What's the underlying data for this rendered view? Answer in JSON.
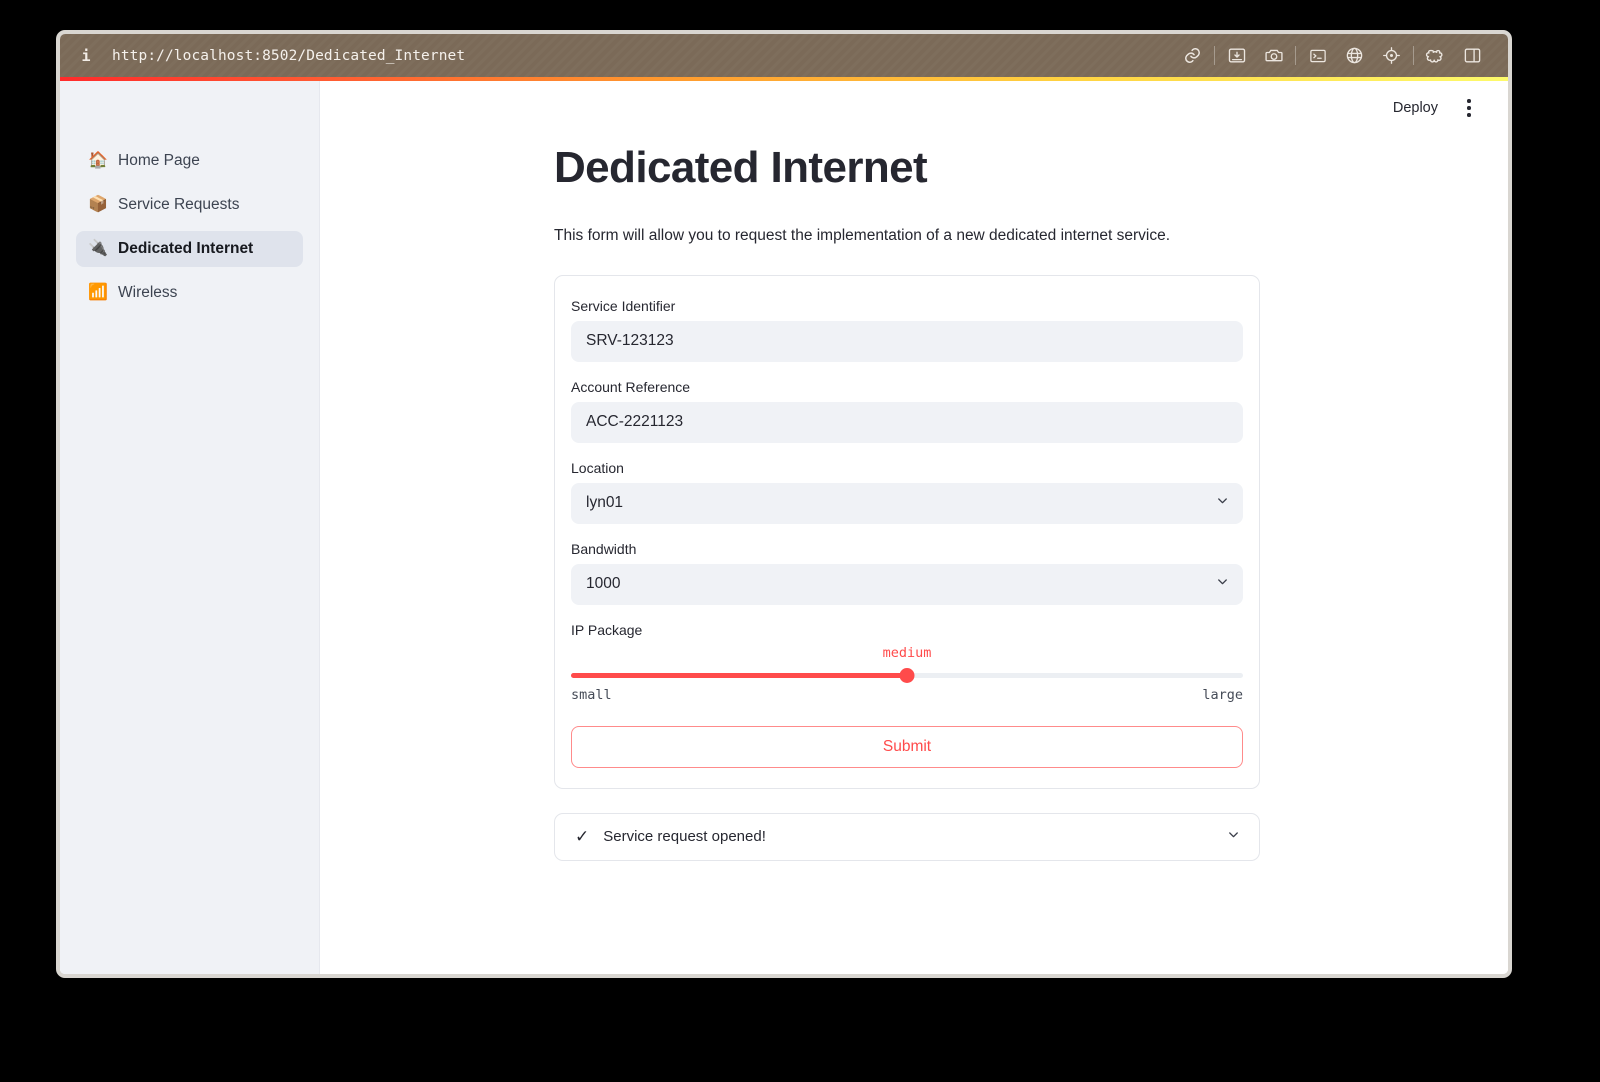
{
  "titlebar": {
    "info_icon": "i",
    "url": "http://localhost:8502/Dedicated_Internet",
    "icons": [
      {
        "name": "link-icon",
        "glyph": "link"
      },
      {
        "name": "download-image-icon",
        "glyph": "image-download"
      },
      {
        "name": "camera-icon",
        "glyph": "camera"
      },
      {
        "name": "terminal-icon",
        "glyph": "terminal"
      },
      {
        "name": "globe-icon",
        "glyph": "globe"
      },
      {
        "name": "crosshair-icon",
        "glyph": "crosshair"
      },
      {
        "name": "puzzle-icon",
        "glyph": "puzzle"
      },
      {
        "name": "split-panel-icon",
        "glyph": "panel"
      }
    ]
  },
  "sidebar": {
    "items": [
      {
        "label": "Home Page",
        "emoji": "🏠",
        "active": false
      },
      {
        "label": "Service Requests",
        "emoji": "📦",
        "active": false
      },
      {
        "label": "Dedicated Internet",
        "emoji": "🔌",
        "active": true
      },
      {
        "label": "Wireless",
        "emoji": "📶",
        "active": false
      }
    ]
  },
  "topbar": {
    "deploy_label": "Deploy",
    "menu_label": "More options"
  },
  "main": {
    "title": "Dedicated Internet",
    "subtitle": "This form will allow you to request the implementation of a new dedicated internet service."
  },
  "form": {
    "fields": [
      {
        "name": "service-identifier",
        "label": "Service Identifier",
        "value": "SRV-123123",
        "placeholder": "",
        "type": "text"
      },
      {
        "name": "account-reference",
        "label": "Account Reference",
        "value": "ACC-2221123",
        "placeholder": "",
        "type": "text"
      },
      {
        "name": "location",
        "label": "Location",
        "value": "lyn01",
        "placeholder": "",
        "type": "select"
      },
      {
        "name": "bandwidth",
        "label": "Bandwidth",
        "value": "1000",
        "placeholder": "",
        "type": "select"
      }
    ],
    "slider": {
      "label": "IP Package",
      "value": "medium",
      "min_label": "small",
      "max_label": "large",
      "percent": 50
    },
    "submit_label": "Submit"
  },
  "status": {
    "check_glyph": "✓",
    "text": "Service request opened!",
    "expanded": false
  },
  "colors": {
    "accent_red": "#ff4b4b",
    "titlebar_brown": "#7b6a58",
    "sidebar_bg": "#f0f2f6",
    "input_bg": "#f0f2f6",
    "text": "#262730"
  }
}
